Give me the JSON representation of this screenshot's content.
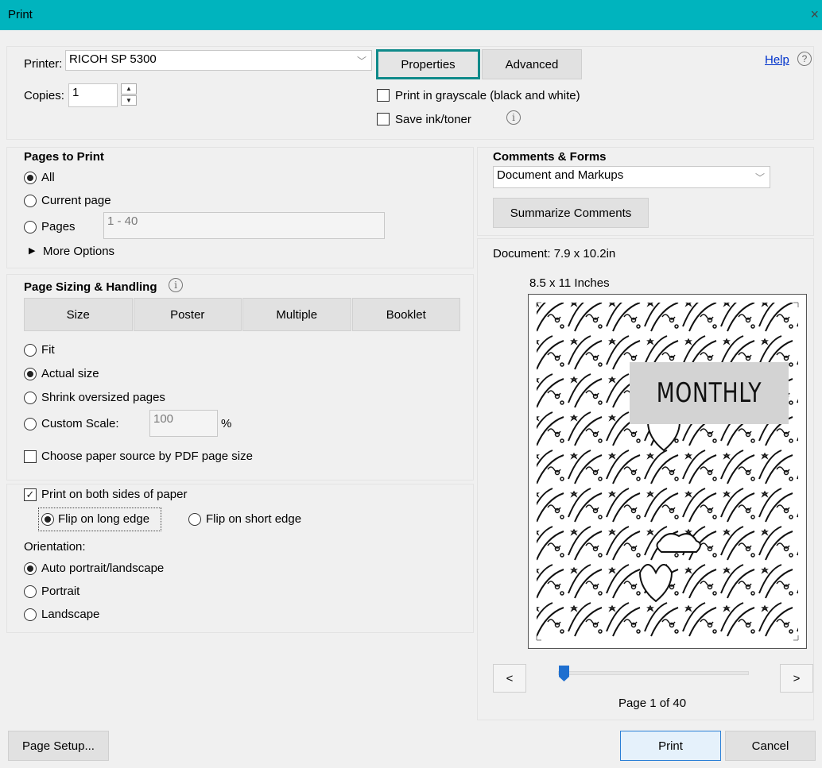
{
  "window": {
    "title": "Print",
    "close_glyph": "×"
  },
  "printer": {
    "label": "Printer:",
    "value": "RICOH SP 5300",
    "properties_label": "Properties",
    "advanced_label": "Advanced",
    "help_label": "Help",
    "help_icon": "?",
    "copies_label": "Copies:",
    "copies_value": "1",
    "grayscale_label": "Print in grayscale (black and white)",
    "grayscale_checked": false,
    "save_ink_label": "Save ink/toner",
    "save_ink_checked": false,
    "info_glyph": "i"
  },
  "pages_to_print": {
    "title": "Pages to Print",
    "options": [
      {
        "label": "All",
        "selected": true
      },
      {
        "label": "Current page",
        "selected": false
      },
      {
        "label": "Pages",
        "selected": false
      }
    ],
    "pages_range_value": "1 - 40",
    "more_options_label": "More Options",
    "more_options_glyph": "▶"
  },
  "page_sizing": {
    "title": "Page Sizing & Handling",
    "tabs": [
      "Size",
      "Poster",
      "Multiple",
      "Booklet"
    ],
    "options": [
      {
        "label": "Fit",
        "selected": false
      },
      {
        "label": "Actual size",
        "selected": true
      },
      {
        "label": "Shrink oversized pages",
        "selected": false
      },
      {
        "label": "Custom Scale:",
        "selected": false
      }
    ],
    "custom_scale_value": "100",
    "percent_sign": "%",
    "paper_source_label": "Choose paper source by PDF page size",
    "paper_source_checked": false
  },
  "duplex": {
    "both_sides_label": "Print on both sides of paper",
    "both_sides_checked": true,
    "check_glyph": "✓",
    "flip_long_label": "Flip on long edge",
    "flip_long_selected": true,
    "flip_short_label": "Flip on short edge",
    "flip_short_selected": false
  },
  "orientation": {
    "title": "Orientation:",
    "options": [
      {
        "label": "Auto portrait/landscape",
        "selected": true
      },
      {
        "label": "Portrait",
        "selected": false
      },
      {
        "label": "Landscape",
        "selected": false
      }
    ]
  },
  "comments_forms": {
    "title": "Comments & Forms",
    "value": "Document and Markups",
    "summarize_label": "Summarize Comments"
  },
  "preview": {
    "document_size": "Document: 7.9 x 10.2in",
    "paper_size": "8.5 x 11 Inches",
    "cover_text": "MONTHLY",
    "prev_label": "<",
    "next_label": ">",
    "page_indicator": "Page 1 of 40",
    "current_page": 1,
    "total_pages": 40
  },
  "footer": {
    "page_setup_label": "Page Setup...",
    "print_label": "Print",
    "cancel_label": "Cancel"
  },
  "colors": {
    "title_bar": "#00b4be",
    "focus_ring": "#0f8a8a",
    "slider_thumb": "#1e6fd0",
    "link": "#0033cc"
  }
}
